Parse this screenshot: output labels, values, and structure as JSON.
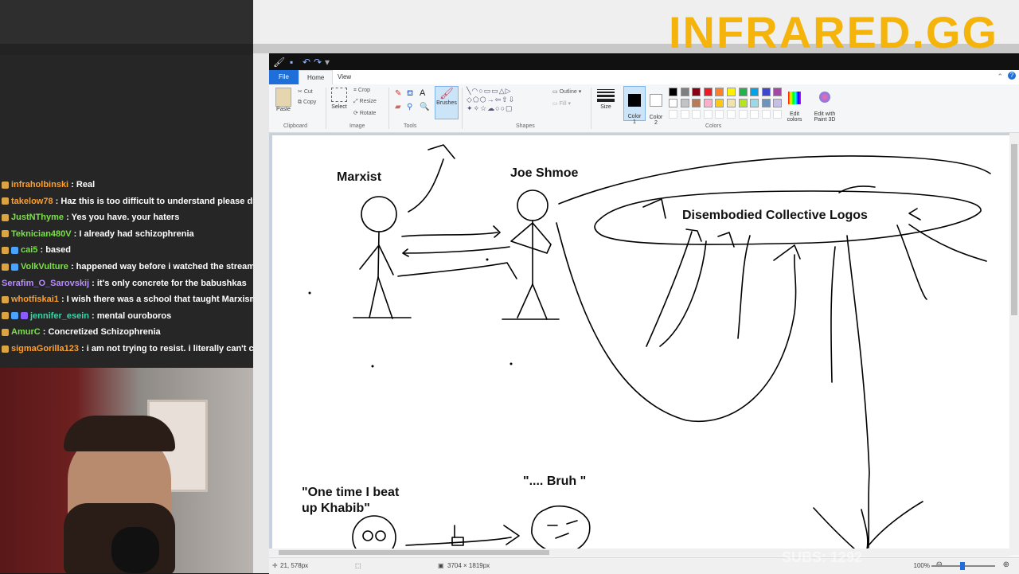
{
  "brand": "INFRARED.GG",
  "subs": "SUBS: 1292",
  "chat": [
    {
      "user": "infraholbinski",
      "msg": " : Real",
      "color": "#ff9f2b",
      "badges": 1
    },
    {
      "user": "takelow78",
      "msg": " : Haz this is too difficult to understand please dro",
      "color": "#ff9f2b",
      "badges": 1
    },
    {
      "user": "JustNThyme",
      "msg": " : Yes you have. your haters",
      "color": "#7be04a",
      "badges": 1
    },
    {
      "user": "Teknician480V",
      "msg": " : I already had schizophrenia",
      "color": "#7be04a",
      "badges": 1
    },
    {
      "user": "cai5",
      "msg": " : based",
      "color": "#7be04a",
      "badges": 2
    },
    {
      "user": "VolkVulture",
      "msg": " : happened way before i watched the streams",
      "color": "#7be04a",
      "badges": 2
    },
    {
      "user": "Serafim_O_Sarovskij",
      "msg": " : it's only concrete for the babushkas",
      "color": "#b78cff",
      "badges": 0
    },
    {
      "user": "whotfiskai1",
      "msg": " : I wish there was a school that taught Marxism",
      "color": "#ff9f2b",
      "badges": 1
    },
    {
      "user": "jennifer_esein",
      "msg": " : mental ouroboros",
      "color": "#3ad6a8",
      "badges": 3
    },
    {
      "user": "AmurC",
      "msg": " : Concretized Schizophrenia",
      "color": "#7be04a",
      "badges": 1
    },
    {
      "user": "sigmaGorilla123",
      "msg": " : i am not trying to resist. i literally can't cor",
      "color": "#ff9f2b",
      "badges": 1
    }
  ],
  "paint": {
    "tabs": {
      "file": "File",
      "home": "Home",
      "view": "View"
    },
    "clipboard": {
      "paste": "Paste",
      "cut": "Cut",
      "copy": "Copy",
      "label": "Clipboard"
    },
    "image": {
      "select": "Select",
      "crop": "Crop",
      "resize": "Resize",
      "rotate": "Rotate",
      "label": "Image"
    },
    "tools": {
      "label": "Tools",
      "brushes": "Brushes"
    },
    "shapes": {
      "outline": "Outline",
      "fill": "Fill",
      "label": "Shapes"
    },
    "size": "Size",
    "color1": "Color\n1",
    "color2": "Color\n2",
    "colors_label": "Colors",
    "edit_colors": "Edit\ncolors",
    "edit_paint3d": "Edit with\nPaint 3D",
    "palette_row1": [
      "#000000",
      "#7f7f7f",
      "#880015",
      "#ed1c24",
      "#ff7f27",
      "#fff200",
      "#22b14c",
      "#00a2e8",
      "#3f48cc",
      "#a349a4"
    ],
    "palette_row2": [
      "#ffffff",
      "#c3c3c3",
      "#b97a57",
      "#ffaec9",
      "#ffc90e",
      "#efe4b0",
      "#b5e61d",
      "#99d9ea",
      "#7092be",
      "#c8bfe7"
    ],
    "status": {
      "cursor": "21, 578px",
      "size": "3704 × 1819px",
      "zoom": "100%"
    }
  },
  "canvas": {
    "marxist": "Marxist",
    "joe": "Joe Shmoe",
    "logos": "Disembodied Collective Logos",
    "khabib_line1": "\"One time I beat",
    "khabib_line2": "up Khabib\"",
    "bruh": "\".... Bruh \""
  }
}
